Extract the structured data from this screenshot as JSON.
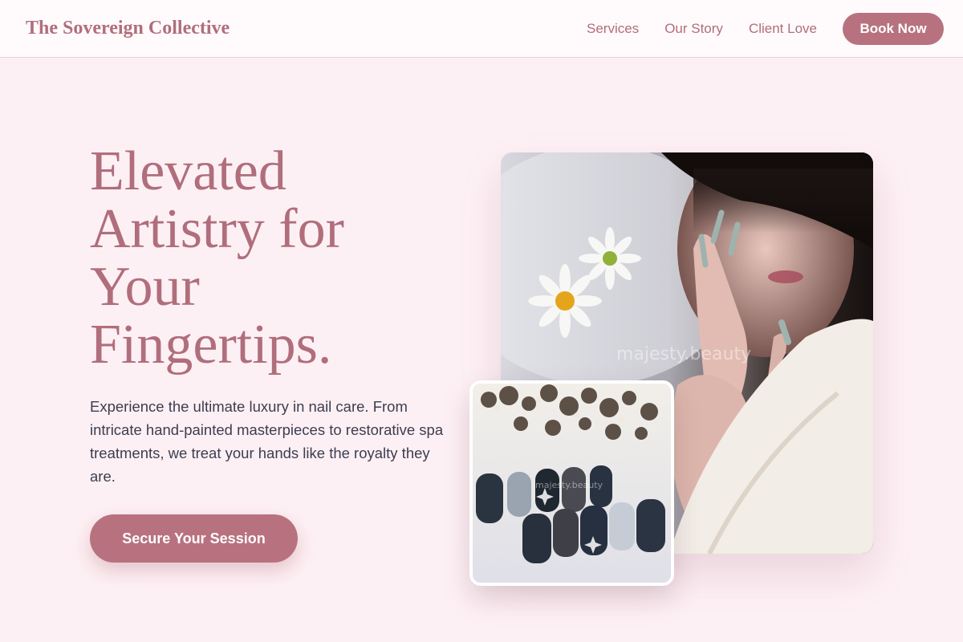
{
  "brand": "The Sovereign Collective",
  "nav": {
    "links": [
      "Services",
      "Our Story",
      "Client Love"
    ],
    "cta": "Book Now"
  },
  "hero": {
    "title_lines": [
      "Elevated",
      "Artistry for",
      "Your",
      "Fingertips."
    ],
    "description": "Experience the ultimate luxury in nail care. From intricate hand-painted masterpieces to restorative spa treatments, we treat your hands like the royalty they are.",
    "cta": "Secure Your Session"
  },
  "images": {
    "main_watermark": "majesty.beauty",
    "small_watermark": "majesty.beauty"
  },
  "colors": {
    "accent": "#b8727f",
    "brand_text": "#b06e7c",
    "background": "#fdf0f4",
    "nav_background": "#fffafc"
  }
}
